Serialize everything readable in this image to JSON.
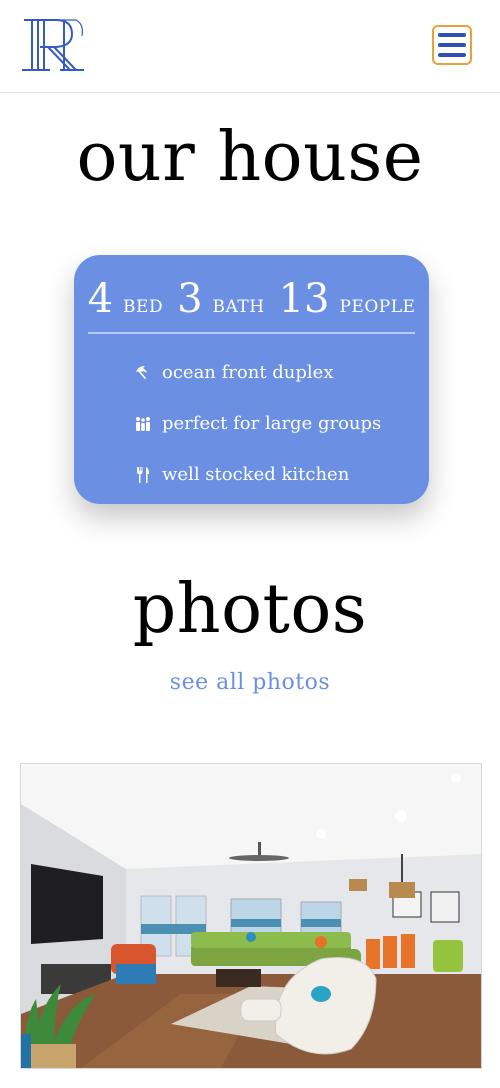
{
  "header": {
    "logo_text": "RR",
    "brand_color": "#3559c9",
    "menu_icon": "hamburger-icon",
    "menu_border_color": "#e8a23a"
  },
  "house": {
    "title": "our house",
    "card_color": "#6b8fe3",
    "stats": [
      {
        "value": "4",
        "label": "BED"
      },
      {
        "value": "3",
        "label": "BATH"
      },
      {
        "value": "13",
        "label": "PEOPLE"
      }
    ],
    "features": [
      {
        "icon": "umbrella-beach-icon",
        "text": "ocean front duplex"
      },
      {
        "icon": "group-people-icon",
        "text": "perfect for large groups"
      },
      {
        "icon": "utensils-icon",
        "text": "well stocked kitchen"
      }
    ]
  },
  "photos": {
    "title": "photos",
    "link_text": "see all photos",
    "link_color": "#6b8fe3"
  }
}
